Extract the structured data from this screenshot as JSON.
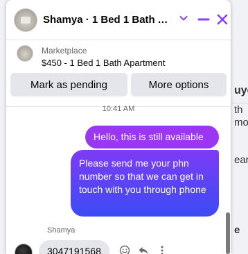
{
  "background_page": {
    "fragments": [
      "uye",
      "th",
      "mo",
      "ear",
      "e"
    ]
  },
  "chat": {
    "title": "Shamya · 1 Bed 1 Bath Apartment",
    "listing": {
      "source": "Marketplace",
      "price_title": "$450 - 1 Bed 1 Bath Apartment",
      "mark_pending_label": "Mark as pending",
      "more_options_label": "More options"
    },
    "timestamp": "10:41 AM",
    "messages_sent": [
      "Hello, this is still available",
      "Please send me your phn number so that we can get in touch with you through phone"
    ],
    "sender_name": "Shamya",
    "received_message": "3047191568",
    "colors": {
      "accent": "#8a3ffc",
      "bubble_top": "#a433f0",
      "bubble_bottom": "#3b4cf5"
    }
  }
}
